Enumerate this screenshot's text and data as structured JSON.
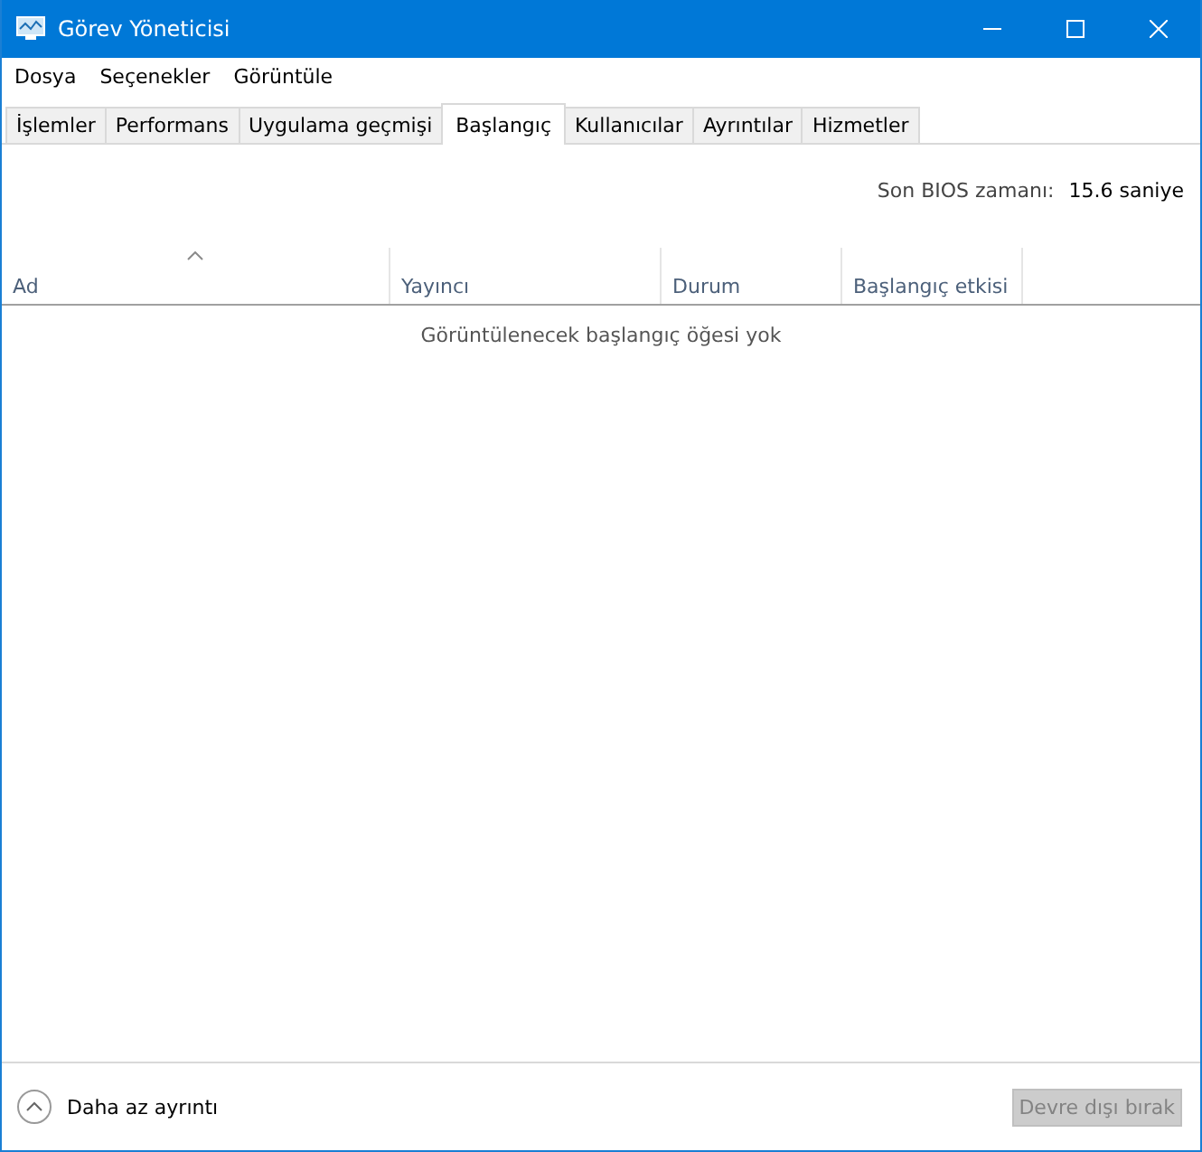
{
  "window": {
    "title": "Görev Yöneticisi"
  },
  "menu": [
    "Dosya",
    "Seçenekler",
    "Görüntüle"
  ],
  "tabs": [
    {
      "label": "İşlemler",
      "selected": false
    },
    {
      "label": "Performans",
      "selected": false
    },
    {
      "label": "Uygulama geçmişi",
      "selected": false
    },
    {
      "label": "Başlangıç",
      "selected": true
    },
    {
      "label": "Kullanıcılar",
      "selected": false
    },
    {
      "label": "Ayrıntılar",
      "selected": false
    },
    {
      "label": "Hizmetler",
      "selected": false
    }
  ],
  "bios": {
    "label": "Son BIOS zamanı:",
    "value": "15.6 saniye"
  },
  "table": {
    "columns": [
      {
        "label": "Ad",
        "sorted": true
      },
      {
        "label": "Yayıncı",
        "sorted": false
      },
      {
        "label": "Durum",
        "sorted": false
      },
      {
        "label": "Başlangıç etkisi",
        "sorted": false
      }
    ],
    "empty_message": "Görüntülenecek başlangıç öğesi yok"
  },
  "footer": {
    "details_link": "Daha az ayrıntı",
    "button": {
      "label": "Devre dışı bırak",
      "disabled": true
    }
  }
}
